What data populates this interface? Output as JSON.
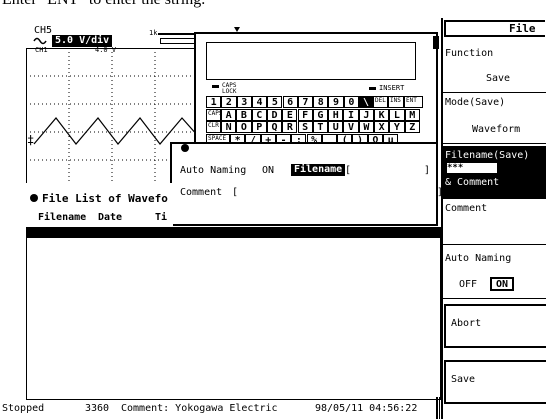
{
  "instruction": "Enter \"ENT\" to enter the string.",
  "channel": {
    "name": "CH5",
    "volt_div": "5.0 V/div",
    "trace_label": "CH1",
    "trace_scale": "4.0 V",
    "pos_marker": "1k"
  },
  "keyboard": {
    "caps_lock": "CAPS LOCK",
    "insert": "INSERT",
    "rows": [
      [
        "1",
        "2",
        "3",
        "4",
        "5",
        "6",
        "7",
        "8",
        "9",
        "0",
        "\\",
        "DEL",
        "INS",
        "ENT"
      ],
      [
        "CAPS",
        "A",
        "B",
        "C",
        "D",
        "E",
        "F",
        "G",
        "H",
        "I",
        "J",
        "K",
        "L",
        "M"
      ],
      [
        "CLR",
        "N",
        "O",
        "P",
        "Q",
        "R",
        "S",
        "T",
        "U",
        "V",
        "W",
        "X",
        "Y",
        "Z"
      ],
      [
        "SPACE",
        "*",
        "/",
        "+",
        "-",
        ":",
        "%",
        "_",
        "(",
        ")",
        "Ω",
        "µ"
      ]
    ]
  },
  "save_dialog": {
    "auto_naming_label": "Auto Naming",
    "auto_naming_value": "ON",
    "filename_label": "Filename",
    "filename_value": "[",
    "filename_close": "]",
    "comment_label": "Comment",
    "comment_value": "[",
    "comment_close": "]"
  },
  "file_list": {
    "title": "File List of Wavefo",
    "col_filename": "Filename",
    "col_date": "Date",
    "col_time": "Ti"
  },
  "status_bar": {
    "state": "Stopped",
    "count": "3360",
    "comment": "Comment: Yokogawa Electric",
    "datetime": "98/05/11 04:56:22"
  },
  "softkeys": {
    "title": "File",
    "function_label": "Function",
    "function_value": "Save",
    "mode_label": "Mode(Save)",
    "mode_value": "Waveform",
    "filename_label": "Filename(Save)",
    "filename_value": "***",
    "filename_comment": "& Comment",
    "comment_label": "Comment",
    "auto_naming_label": "Auto Naming",
    "auto_off": "OFF",
    "auto_on": "ON",
    "abort": "Abort",
    "save": "Save"
  }
}
